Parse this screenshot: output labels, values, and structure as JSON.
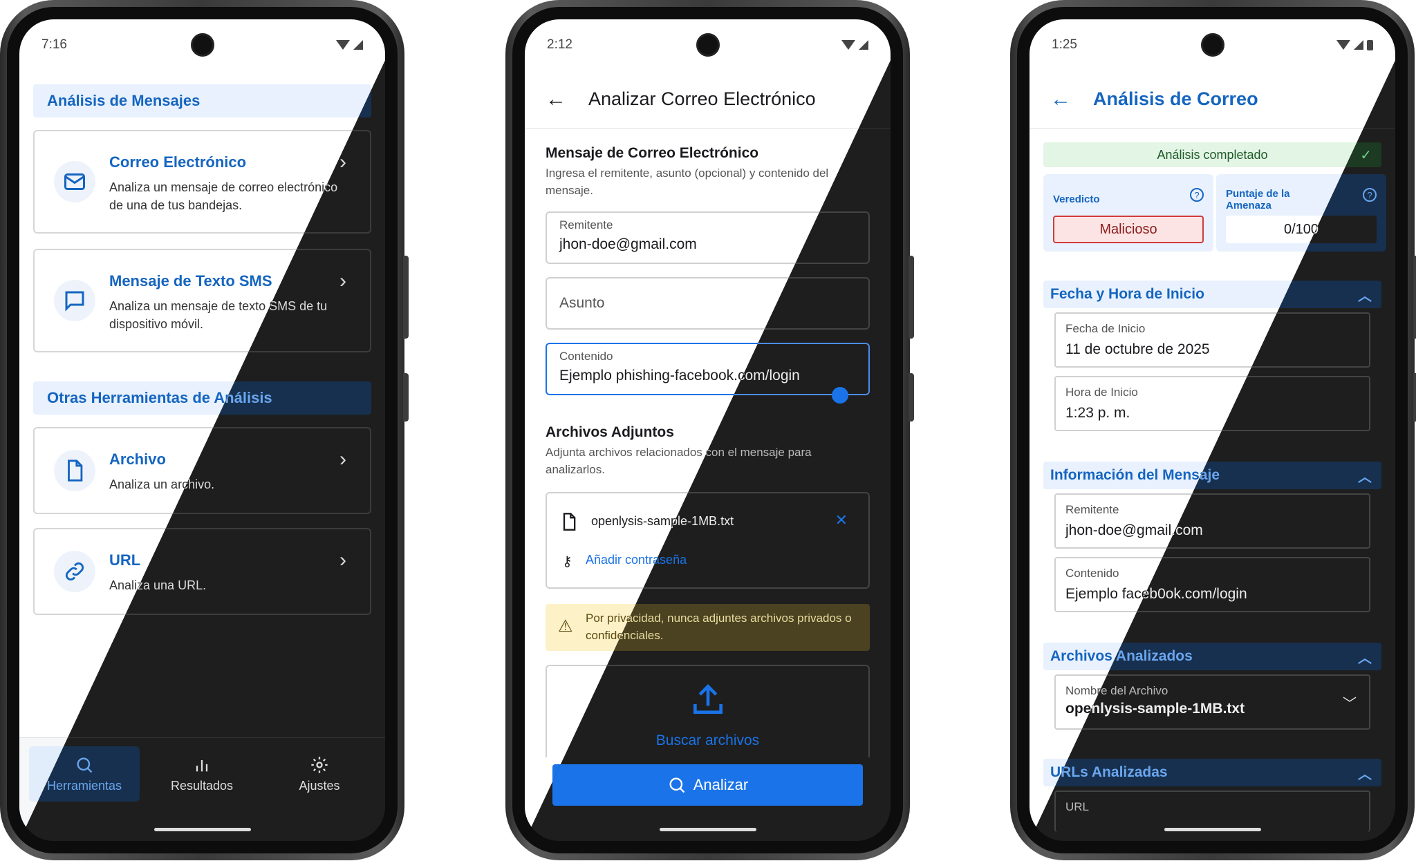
{
  "screen1": {
    "time": "7:16",
    "section_main": "Análisis de Mensajes",
    "cards": [
      {
        "title": "Correo Electrónico",
        "desc": "Analiza un mensaje de correo electrónico de una de tus bandejas.",
        "icon": "mail-icon"
      },
      {
        "title": "Mensaje de Texto SMS",
        "desc": "Analiza un mensaje de texto SMS de tu dispositivo móvil.",
        "icon": "message-icon"
      }
    ],
    "section_other": "Otras Herramientas de Análisis",
    "tools": [
      {
        "title": "Archivo",
        "desc": "Analiza un archivo.",
        "icon": "file-icon"
      },
      {
        "title": "URL",
        "desc": "Analiza una URL.",
        "icon": "link-icon"
      }
    ],
    "nav": [
      {
        "label": "Herramientas",
        "icon": "search-icon"
      },
      {
        "label": "Resultados",
        "icon": "bar-chart-icon"
      },
      {
        "label": "Ajustes",
        "icon": "gear-icon"
      }
    ]
  },
  "screen2": {
    "time": "2:12",
    "title": "Analizar Correo Electrónico",
    "message_title": "Mensaje de Correo Electrónico",
    "message_sub": "Ingresa el remitente, asunto (opcional) y contenido del mensaje.",
    "sender_label": "Remitente",
    "sender_value": "jhon-doe@gmail.com",
    "subject_placeholder": "Asunto",
    "content_label": "Contenido",
    "content_value": "Ejemplo phishing-facebook.com/login",
    "attachments_title": "Archivos Adjuntos",
    "attachments_sub": "Adjunta archivos relacionados con el mensaje para analizarlos.",
    "file_name": "openlysis-sample-1MB.txt",
    "add_password": "Añadir contraseña",
    "privacy_warning": "Por privacidad, nunca adjuntes archivos privados o confidenciales.",
    "browse_files": "Buscar archivos",
    "analyze": "Analizar"
  },
  "screen3": {
    "time": "1:25",
    "title": "Análisis de Correo",
    "banner": "Análisis completado",
    "verdict_label": "Veredicto",
    "verdict_value": "Malicioso",
    "threat_label": "Puntaje de la Amenaza",
    "threat_value": "0/100",
    "start_header": "Fecha y Hora de Inicio",
    "start_date_label": "Fecha de Inicio",
    "start_date_value": "11 de octubre de 2025",
    "start_time_label": "Hora de Inicio",
    "start_time_value": "1:23 p. m.",
    "msg_header": "Información del Mensaje",
    "sender_label": "Remitente",
    "sender_value": "jhon-doe@gmail.com",
    "content_label": "Contenido",
    "content_value": "Ejemplo faceb0ok.com/login",
    "files_header": "Archivos Analizados",
    "file_label": "Nombre del Archivo",
    "file_value": "openlysis-sample-1MB.txt",
    "urls_header": "URLs Analizadas",
    "url_label": "URL"
  },
  "colors": {
    "accent": "#1565c0",
    "accent_dark": "#6aa6ef",
    "button": "#1a73e8",
    "danger": "#d13b3b"
  }
}
